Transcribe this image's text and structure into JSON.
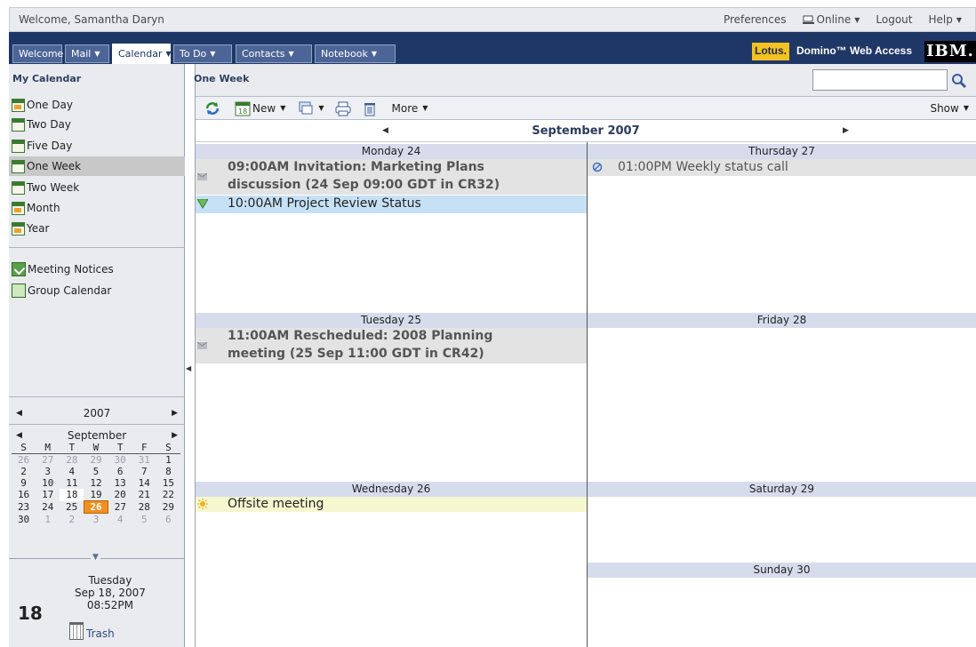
{
  "topbar": {
    "welcome": "Welcome, Samantha Daryn",
    "preferences": "Preferences",
    "online": "Online",
    "logout": "Logout",
    "help": "Help"
  },
  "nav": {
    "tabs": [
      {
        "label": "Welcome"
      },
      {
        "label": "Mail"
      },
      {
        "label": "Calendar"
      },
      {
        "label": "To Do"
      },
      {
        "label": "Contacts"
      },
      {
        "label": "Notebook"
      }
    ],
    "brand_lotus": "Lotus.",
    "brand_product": "Domino™ Web Access",
    "brand_ibm": "IBM."
  },
  "sidebar": {
    "title": "My Calendar",
    "views": [
      {
        "label": "One Day"
      },
      {
        "label": "Two Day"
      },
      {
        "label": "Five Day"
      },
      {
        "label": "One Week"
      },
      {
        "label": "Two Week"
      },
      {
        "label": "Month"
      },
      {
        "label": "Year"
      }
    ],
    "selected_view": "One Week",
    "extras": [
      {
        "label": "Meeting Notices"
      },
      {
        "label": "Group Calendar"
      }
    ],
    "mini_calendar": {
      "year": "2007",
      "month": "September",
      "weekday_headers": [
        "S",
        "M",
        "T",
        "W",
        "T",
        "F",
        "S"
      ],
      "weeks": [
        [
          "26",
          "27",
          "28",
          "29",
          "30",
          "31",
          "1"
        ],
        [
          "2",
          "3",
          "4",
          "5",
          "6",
          "7",
          "8"
        ],
        [
          "9",
          "10",
          "11",
          "12",
          "13",
          "14",
          "15"
        ],
        [
          "16",
          "17",
          "18",
          "19",
          "20",
          "21",
          "22"
        ],
        [
          "23",
          "24",
          "25",
          "26",
          "27",
          "28",
          "29"
        ],
        [
          "30",
          "1",
          "2",
          "3",
          "4",
          "5",
          "6"
        ]
      ],
      "today": "18",
      "selected": "26"
    },
    "current_date": {
      "day_number": "18",
      "weekday": "Tuesday",
      "date": "Sep 18, 2007",
      "time": "08:52PM"
    },
    "trash": "Trash"
  },
  "main": {
    "title": "One Week",
    "search": {
      "value": "",
      "placeholder": ""
    },
    "toolbar": {
      "new": "New",
      "more": "More",
      "show": "Show"
    },
    "month_label": "September 2007",
    "days": {
      "mon": {
        "label": "Monday 24"
      },
      "tue": {
        "label": "Tuesday 25"
      },
      "wed": {
        "label": "Wednesday 26"
      },
      "thu": {
        "label": "Thursday 27"
      },
      "fri": {
        "label": "Friday 28"
      },
      "sat": {
        "label": "Saturday 29"
      },
      "sun": {
        "label": "Sunday 30"
      }
    },
    "entries": {
      "mon_1_line1": "09:00AM Invitation: Marketing Plans",
      "mon_1_line2": "discussion (24 Sep 09:00 GDT in CR32)",
      "mon_2": "10:00AM Project Review Status",
      "tue_1_line1": "11:00AM Rescheduled: 2008 Planning",
      "tue_1_line2": "meeting (25 Sep 11:00 GDT in CR42)",
      "wed_1": "Offsite meeting",
      "thu_1": "01:00PM Weekly status call"
    }
  }
}
